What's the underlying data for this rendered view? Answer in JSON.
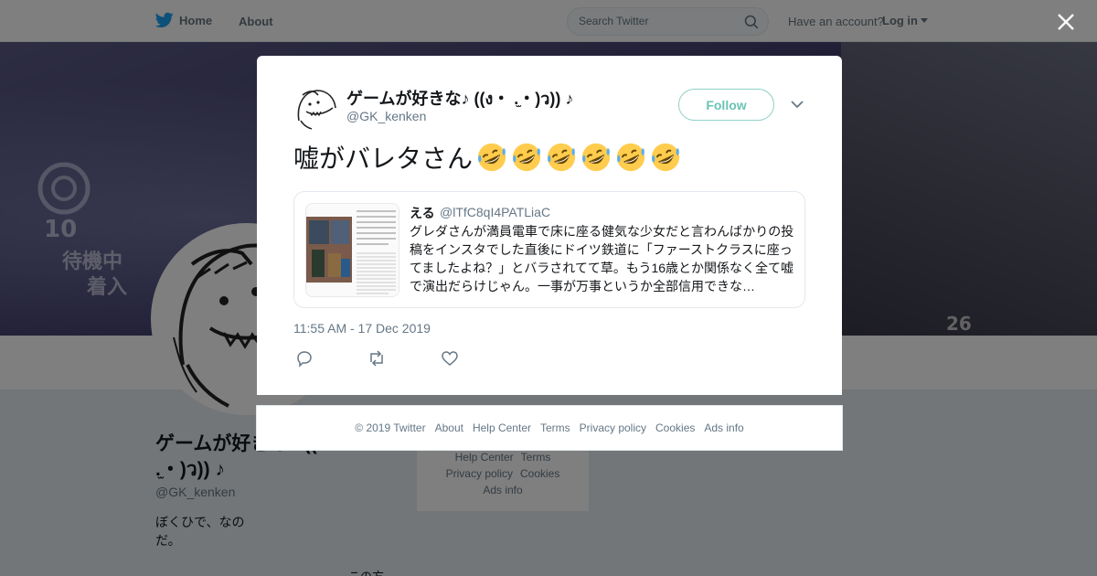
{
  "nav": {
    "home_label": "Home",
    "about_label": "About",
    "search_placeholder": "Search Twitter",
    "have_account": "Have an account?",
    "login_label": "Log in",
    "brand_color": "#1da1f2"
  },
  "banner": {
    "label_left_1": "10",
    "label_left_2": "待機中",
    "label_left_3": "着入",
    "label_right": "26"
  },
  "profile": {
    "name": "ゲームが好きな♪ ((ง・ .̫・)ว)) ♪",
    "handle": "@GK_kenken",
    "bio": "ぼくひで、なのだ。",
    "extra": "この方"
  },
  "background_footer": {
    "links": [
      "Help Center",
      "Terms",
      "Privacy policy",
      "Cookies",
      "Ads info"
    ]
  },
  "modal": {
    "name": "ゲームが好きな♪ ((ง・ .̫・)ว)) ♪",
    "handle": "@GK_kenken",
    "follow_label": "Follow",
    "tweet_text": "嘘がバレタさん",
    "emoji_name": "rolling-on-the-floor-laughing",
    "emoji_count": 6,
    "quote": {
      "name": "える",
      "handle": "@lTfC8qI4PATLiaC",
      "text": "グレダさんが満員電車で床に座る健気な少女だと言わんばかりの投稿をインスタでした直後にドイツ鉄道に「ファーストクラスに座ってましたよね？」とバラされてて草。もう16歳とか関係なく全て嘘で演出だらけじゃん。一事が万事というか全部信用できな…"
    },
    "timestamp": "11:55 AM - 17 Dec 2019",
    "actions": [
      "reply-icon",
      "retweet-icon",
      "like-icon"
    ]
  },
  "modal_footer": {
    "copyright": "© 2019 Twitter",
    "links": [
      "About",
      "Help Center",
      "Terms",
      "Privacy policy",
      "Cookies",
      "Ads info"
    ]
  }
}
